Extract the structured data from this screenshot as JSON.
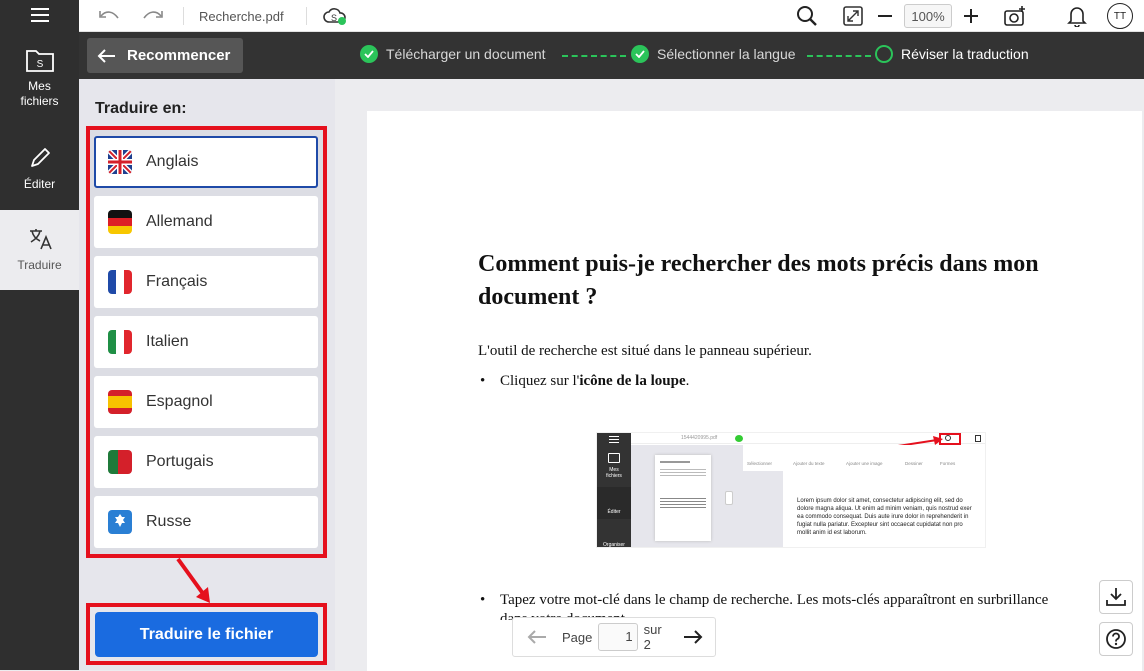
{
  "sidebar": {
    "items": [
      {
        "label_line1": "Mes",
        "label_line2": "fichiers"
      },
      {
        "label": "Éditer"
      },
      {
        "label": "Traduire"
      }
    ]
  },
  "topbar": {
    "filename": "Recherche.pdf",
    "zoom": "100%",
    "avatar": "TT"
  },
  "progress": {
    "restart_label": "Recommencer",
    "steps": [
      {
        "label": "Télécharger un document",
        "status": "done"
      },
      {
        "label": "Sélectionner la langue",
        "status": "done"
      },
      {
        "label": "Réviser la traduction",
        "status": "current"
      }
    ]
  },
  "panel": {
    "heading": "Traduire en:",
    "languages": [
      {
        "label": "Anglais",
        "flag": "uk-flag-icon",
        "selected": true
      },
      {
        "label": "Allemand",
        "flag": "germany-flag-icon"
      },
      {
        "label": "Français",
        "flag": "france-flag-icon"
      },
      {
        "label": "Italien",
        "flag": "italy-flag-icon"
      },
      {
        "label": "Espagnol",
        "flag": "spain-flag-icon"
      },
      {
        "label": "Portugais",
        "flag": "portugal-flag-icon"
      },
      {
        "label": "Russe",
        "flag": "russia-flag-icon"
      }
    ],
    "translate_button": "Traduire le fichier"
  },
  "document": {
    "title": "Comment puis-je rechercher des mots précis dans mon document ?",
    "intro": "L'outil de recherche est situé dans le panneau supérieur.",
    "bullet1_prefix": "Cliquez sur l'",
    "bullet1_bold": "icône de la loupe",
    "bullet1_suffix": ".",
    "bullet2": "Tapez votre mot-clé dans le champ de recherche. Les mots-clés apparaîtront en surbrillance",
    "bullet2_cut": "dans votre document.",
    "screenshot": {
      "filename": "1544420995.pdf",
      "side_mes": "Mes",
      "side_fichiers": "fichiers",
      "side_editer": "Éditer",
      "side_organiser": "Organiser",
      "tools": [
        "Sélectionner",
        "Ajouter du texte",
        "Ajouter une image",
        "Dessiner",
        "Formes"
      ],
      "lorem": [
        "Lorem ipsum dolor sit amet, consectetur adipiscing elit, sed do",
        "dolore magna aliqua. Ut enim ad minim veniam, quis nostrud exer",
        "ea commodo consequat. Duis aute irure dolor in reprehenderit in",
        "fugiat nulla pariatur. Excepteur sint occaecat cupidatat non pro",
        "mollit anim id est laborum."
      ]
    }
  },
  "pager": {
    "label": "Page",
    "current": "1",
    "total_label": "sur 2"
  },
  "colors": {
    "accent_blue": "#1a6be0",
    "highlight_red": "#e5101d",
    "step_green": "#2bc45a",
    "sidebar_bg": "#2f2f2f"
  }
}
